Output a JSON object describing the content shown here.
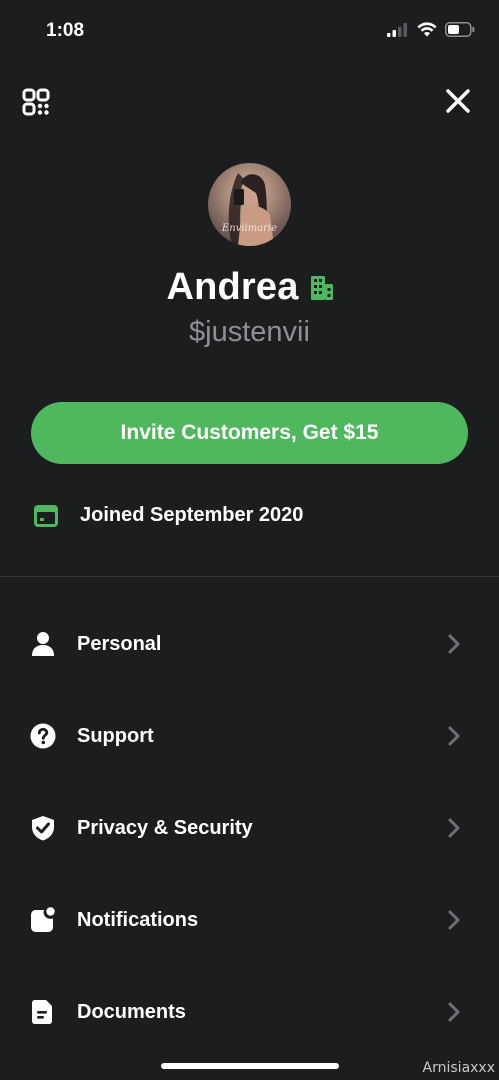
{
  "status_bar": {
    "time": "1:08",
    "icons": [
      "cellular-signal-icon",
      "wifi-icon",
      "battery-icon"
    ]
  },
  "top_bar": {
    "left_icon": "qr-code-icon",
    "right_icon": "close-icon"
  },
  "profile": {
    "avatar_signature": "Enviimarie",
    "name": "Andrea",
    "business_badge_icon": "building-icon",
    "cashtag": "$justenvii"
  },
  "invite_button": {
    "label": "Invite Customers, Get $15"
  },
  "joined": {
    "icon": "card-icon",
    "text": "Joined September 2020"
  },
  "menu": {
    "items": [
      {
        "label": "Personal",
        "icon": "person-icon"
      },
      {
        "label": "Support",
        "icon": "question-icon"
      },
      {
        "label": "Privacy & Security",
        "icon": "shield-check-icon"
      },
      {
        "label": "Notifications",
        "icon": "notification-icon"
      },
      {
        "label": "Documents",
        "icon": "document-icon"
      }
    ]
  },
  "watermark": "Arnisiaxxx",
  "colors": {
    "background": "#1c1d1f",
    "accent_green": "#4fb85f",
    "muted_text": "#8e8f93",
    "chevron": "#6f7074"
  }
}
